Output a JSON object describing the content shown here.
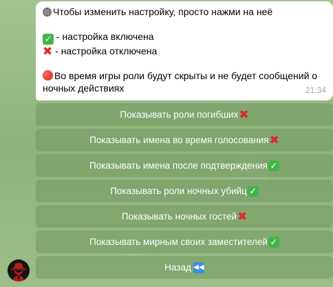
{
  "message": {
    "line1": "Чтобы изменить настройку, просто нажми на неё",
    "line2": " - настройка включена",
    "line3": " - настройка отключена",
    "line4": "Во время игры роли будут скрыты и не будет сообщений о",
    "line5": "ночных действиях",
    "time": "21:34",
    "icons": [
      "gear-icon",
      "check-icon",
      "cross-icon",
      "red-circle-icon"
    ]
  },
  "keyboard": {
    "buttons": [
      {
        "label": "Показывать роли погибших",
        "status": "off"
      },
      {
        "label": "Показывать имена во время голосования",
        "status": "off"
      },
      {
        "label": "Показывать имена после подтверждения",
        "status": "on"
      },
      {
        "label": "Показывать роли ночных убийц",
        "status": "on"
      },
      {
        "label": "Показывать ночных гостей",
        "status": "off"
      },
      {
        "label": "Показывать мирным своих заместителей",
        "status": "on"
      },
      {
        "label": "Назад",
        "status": "back"
      }
    ]
  },
  "colors": {
    "on": "#44b54a",
    "off": "#e0262b",
    "back": "#3a8ee6",
    "button_bg": "#7aa068",
    "chat_bg": "#8fb57c"
  }
}
